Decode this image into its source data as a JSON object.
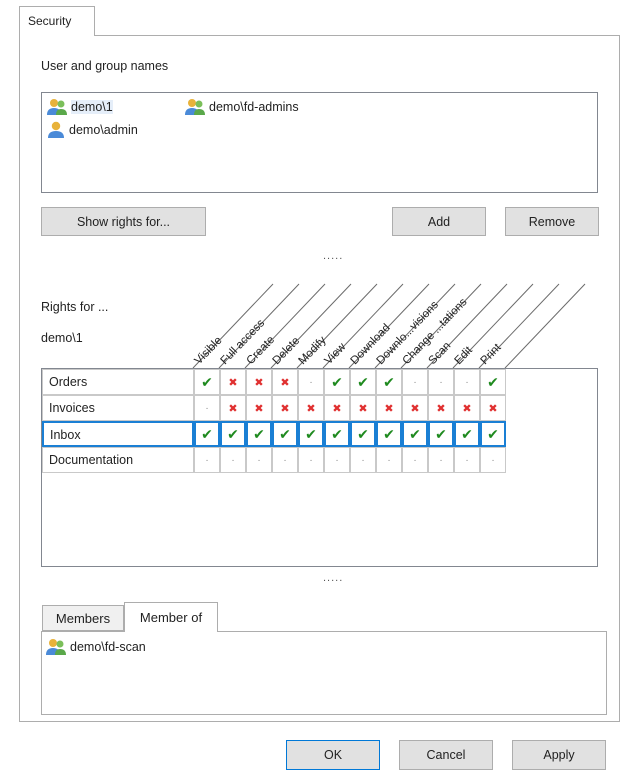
{
  "tab": {
    "label": "Security"
  },
  "users": {
    "label": "User and group names",
    "items": [
      {
        "name": "demo\\1",
        "icon": "group-icon"
      },
      {
        "name": "demo\\fd-admins",
        "icon": "group-icon"
      },
      {
        "name": "demo\\admin",
        "icon": "user-icon"
      }
    ]
  },
  "buttons": {
    "show_rights": "Show rights for...",
    "add": "Add",
    "remove": "Remove",
    "ok": "OK",
    "cancel": "Cancel",
    "apply": "Apply"
  },
  "splitter": {
    "dots": "....."
  },
  "rights": {
    "title": "Rights for ...",
    "subject": "demo\\1",
    "columns": [
      "Visible",
      "Full access",
      "Create",
      "Delete",
      "Modify",
      "View",
      "Download",
      "Downlo...visions",
      "Change ...tations",
      "Scan",
      "Edit",
      "Print"
    ],
    "rows": [
      {
        "name": "Orders",
        "values": [
          "check",
          "cross",
          "cross",
          "cross",
          "dot",
          "check",
          "check",
          "check",
          "dot",
          "dot",
          "dot",
          "check"
        ]
      },
      {
        "name": "Invoices",
        "values": [
          "dot",
          "cross",
          "cross",
          "cross",
          "cross",
          "cross",
          "cross",
          "cross",
          "cross",
          "cross",
          "cross",
          "cross"
        ]
      },
      {
        "name": "Inbox",
        "values": [
          "check",
          "check",
          "check",
          "check",
          "check",
          "check",
          "check",
          "check",
          "check",
          "check",
          "check",
          "check"
        ]
      },
      {
        "name": "Documentation",
        "values": [
          "dot",
          "dot",
          "dot",
          "dot",
          "dot",
          "dot",
          "dot",
          "dot",
          "dot",
          "dot",
          "dot",
          "dot"
        ]
      }
    ],
    "selected_row": "Inbox"
  },
  "member_tabs": {
    "tabs": [
      "Members",
      "Member of"
    ],
    "active": "Member of",
    "items": [
      {
        "name": "demo\\fd-scan",
        "icon": "group-icon"
      }
    ]
  },
  "colors": {
    "check": "#1f8a1f",
    "cross": "#e03030",
    "highlight": "#1a7fd4"
  }
}
